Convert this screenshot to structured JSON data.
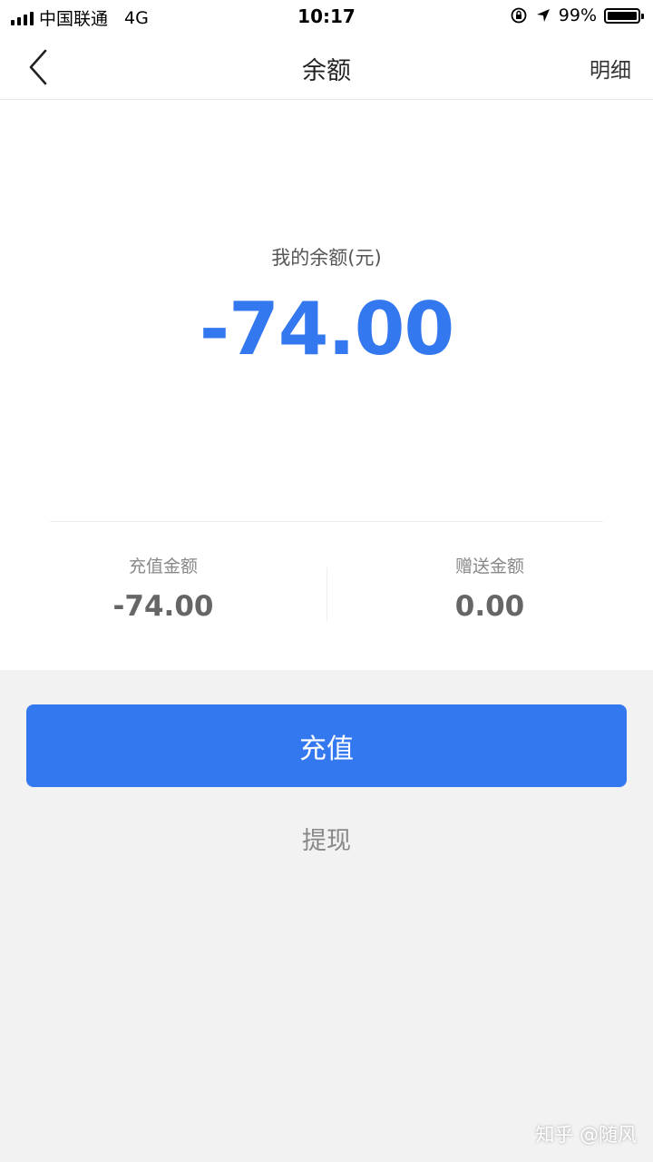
{
  "status_bar": {
    "carrier": "中国联通",
    "network": "4G",
    "time": "10:17",
    "battery": "99%",
    "battery_level": 0.99
  },
  "nav": {
    "title": "余额",
    "detail": "明细",
    "back_icon": "chevron-left-icon"
  },
  "balance": {
    "label": "我的余额(元)",
    "amount": "-74.00"
  },
  "stats": {
    "recharge_label": "充值金额",
    "recharge_value": "-74.00",
    "bonus_label": "赠送金额",
    "bonus_value": "0.00"
  },
  "actions": {
    "recharge": "充值",
    "withdraw": "提现"
  },
  "watermark": "知乎 @随风",
  "colors": {
    "accent": "#3478f0",
    "background": "#f2f2f2"
  }
}
